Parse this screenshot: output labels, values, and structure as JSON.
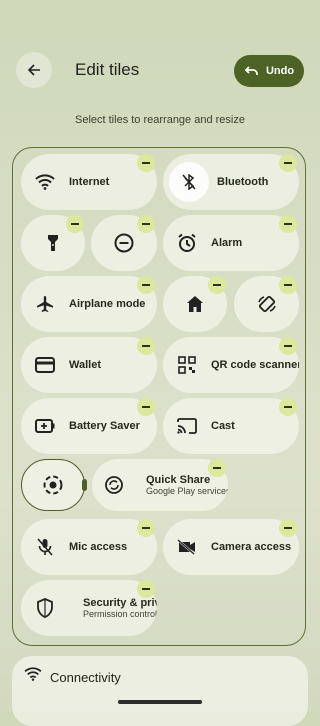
{
  "header": {
    "title": "Edit tiles",
    "undo_label": "Undo"
  },
  "subtitle": "Select tiles to rearrange and resize",
  "tiles": {
    "internet": "Internet",
    "bluetooth": "Bluetooth",
    "alarm": "Alarm",
    "airplane": "Airplane mode",
    "wallet": "Wallet",
    "qr": "QR code scanner",
    "battery": "Battery Saver",
    "cast": "Cast",
    "quick_share": "Quick Share",
    "quick_share_sub": "Google Play services",
    "mic": "Mic access",
    "camera": "Camera access",
    "security": "Security & privacy",
    "security_sub": "Permission controls"
  },
  "section": {
    "connectivity": "Connectivity"
  },
  "colors": {
    "accent": "#4d6326",
    "minus_badge": "#dbe89d",
    "frame": "#5f7033"
  }
}
